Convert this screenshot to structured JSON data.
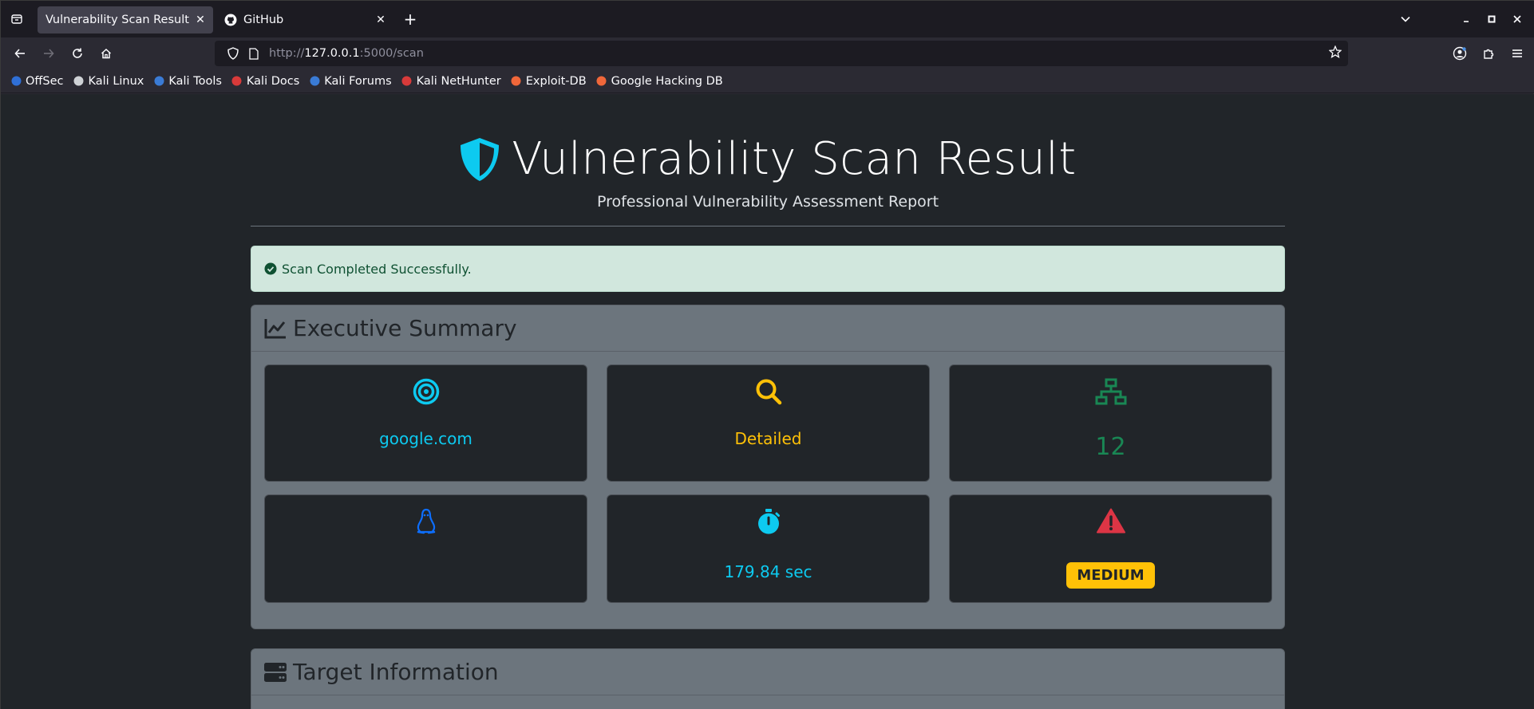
{
  "browser": {
    "tabs": [
      {
        "label": "Vulnerability Scan Result",
        "active": true
      },
      {
        "label": "GitHub",
        "active": false
      }
    ],
    "url_scheme": "http://",
    "url_host": "127.0.0.1",
    "url_path": ":5000/scan",
    "bookmarks": [
      {
        "label": "OffSec",
        "color": "#2f6fd6"
      },
      {
        "label": "Kali Linux",
        "color": "#cfd2d6"
      },
      {
        "label": "Kali Tools",
        "color": "#3a7bd5"
      },
      {
        "label": "Kali Docs",
        "color": "#d83a3a"
      },
      {
        "label": "Kali Forums",
        "color": "#3a7bd5"
      },
      {
        "label": "Kali NetHunter",
        "color": "#d83a3a"
      },
      {
        "label": "Exploit-DB",
        "color": "#f0673a"
      },
      {
        "label": "Google Hacking DB",
        "color": "#f0673a"
      }
    ]
  },
  "page": {
    "title": "Vulnerability Scan Result",
    "subtitle": "Professional Vulnerability Assessment Report",
    "alert": "Scan Completed Successfully.",
    "summary": {
      "header": "Executive Summary",
      "target": "google.com",
      "scan_type": "Detailed",
      "open_ports": "12",
      "os": "",
      "duration": "179.84 sec",
      "risk": "MEDIUM"
    },
    "target_info": {
      "header": "Target Information"
    }
  },
  "colors": {
    "accent_cyan": "#0dcaf0",
    "accent_yellow": "#ffc107",
    "accent_green": "#198754",
    "accent_blue": "#0d6efd",
    "accent_red": "#dc3545"
  }
}
